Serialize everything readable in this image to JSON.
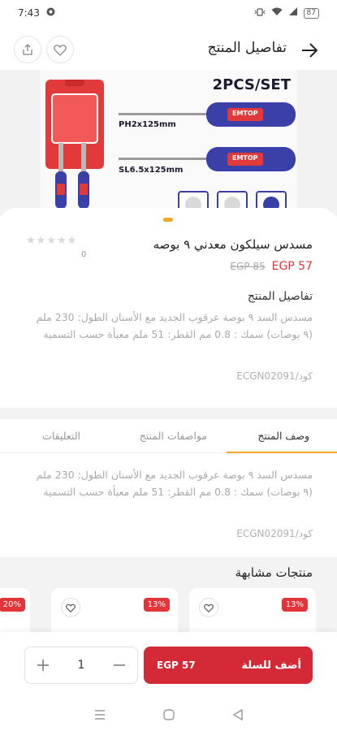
{
  "status": {
    "time": "7:43",
    "battery": "87"
  },
  "header": {
    "title": "تفاصيل المنتج"
  },
  "image": {
    "set_label": "2PCS/SET",
    "spec1": "PH2x125mm",
    "spec2": "SL6.5x125mm",
    "brand": "EMTOP"
  },
  "product": {
    "name": "مسدس سيلكون معدني ٩ بوصه",
    "price": "EGP 57",
    "old_price": "EGP 85",
    "rating_count": "0",
    "details_title": "تفاصيل المنتج",
    "description": "مسدس السد ٩ بوصة عرقوب الجديد مع الأسنان الطول: 230 ملم (٩ بوصات) سمك   : 0.8 مم القطر: 51 ملم معبأة حسب التسمية",
    "code": "كود/ECGN02091"
  },
  "tabs": [
    {
      "label": "وصف المنتج"
    },
    {
      "label": "مواصفات المنتج"
    },
    {
      "label": "التعليقات"
    }
  ],
  "similar": {
    "title": "منتجات مشابهة",
    "cards": [
      {
        "badge": "13%"
      },
      {
        "badge": "13%"
      },
      {
        "badge": "20%"
      }
    ]
  },
  "cart": {
    "add_label": "أضف للسلة",
    "price": "EGP 57",
    "quantity": "1"
  },
  "colors": {
    "accent": "#f5a623",
    "primary": "#d42a36",
    "sale": "#e3343a"
  }
}
